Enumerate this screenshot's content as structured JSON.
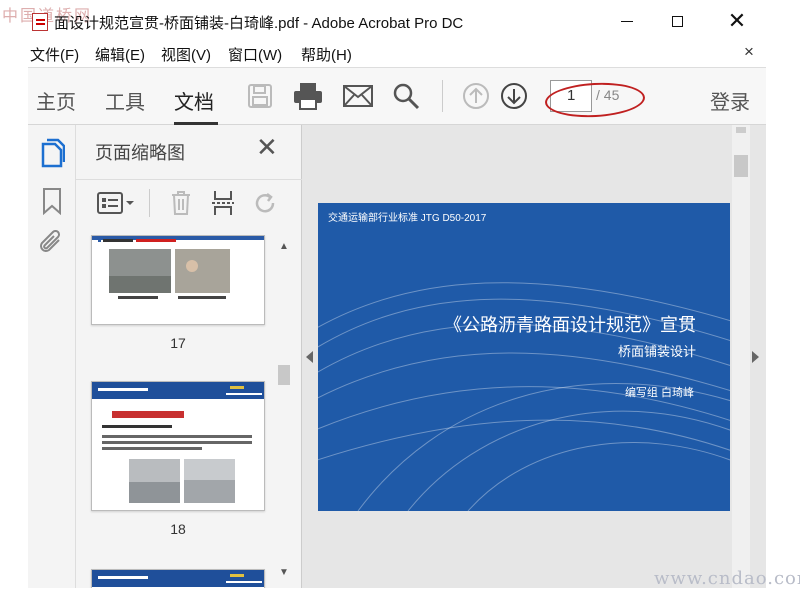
{
  "window": {
    "title": "面设计规范宣贯-桥面铺装-白琦峰.pdf - Adobe Acrobat Pro DC",
    "watermark_top": "中国道桥网",
    "watermark_bottom": "www.cndao.com"
  },
  "menu": {
    "items": [
      "文件(F)",
      "编辑(E)",
      "视图(V)",
      "窗口(W)",
      "帮助(H)"
    ],
    "close": "×"
  },
  "toolbar": {
    "tabs": [
      "主页",
      "工具",
      "文档"
    ],
    "active_tab": "文档",
    "icons": [
      "save-icon",
      "print-icon",
      "email-icon",
      "search-icon",
      "prev-page-icon",
      "next-page-icon"
    ],
    "page_current": "1",
    "page_total": "/ 45",
    "login": "登录"
  },
  "thumbnails": {
    "title": "页面缩略图",
    "items": [
      {
        "page": "17"
      },
      {
        "page": "18"
      }
    ]
  },
  "document": {
    "standard": "交通运输部行业标准  JTG D50-2017",
    "title": "《公路沥青路面设计规范》宣贯",
    "subtitle": "桥面铺装设计",
    "author": "编写组    白琦峰",
    "background": "#1f5aa8"
  },
  "colors": {
    "accent_red": "#c02020",
    "doc_blue": "#1f5aa8"
  }
}
